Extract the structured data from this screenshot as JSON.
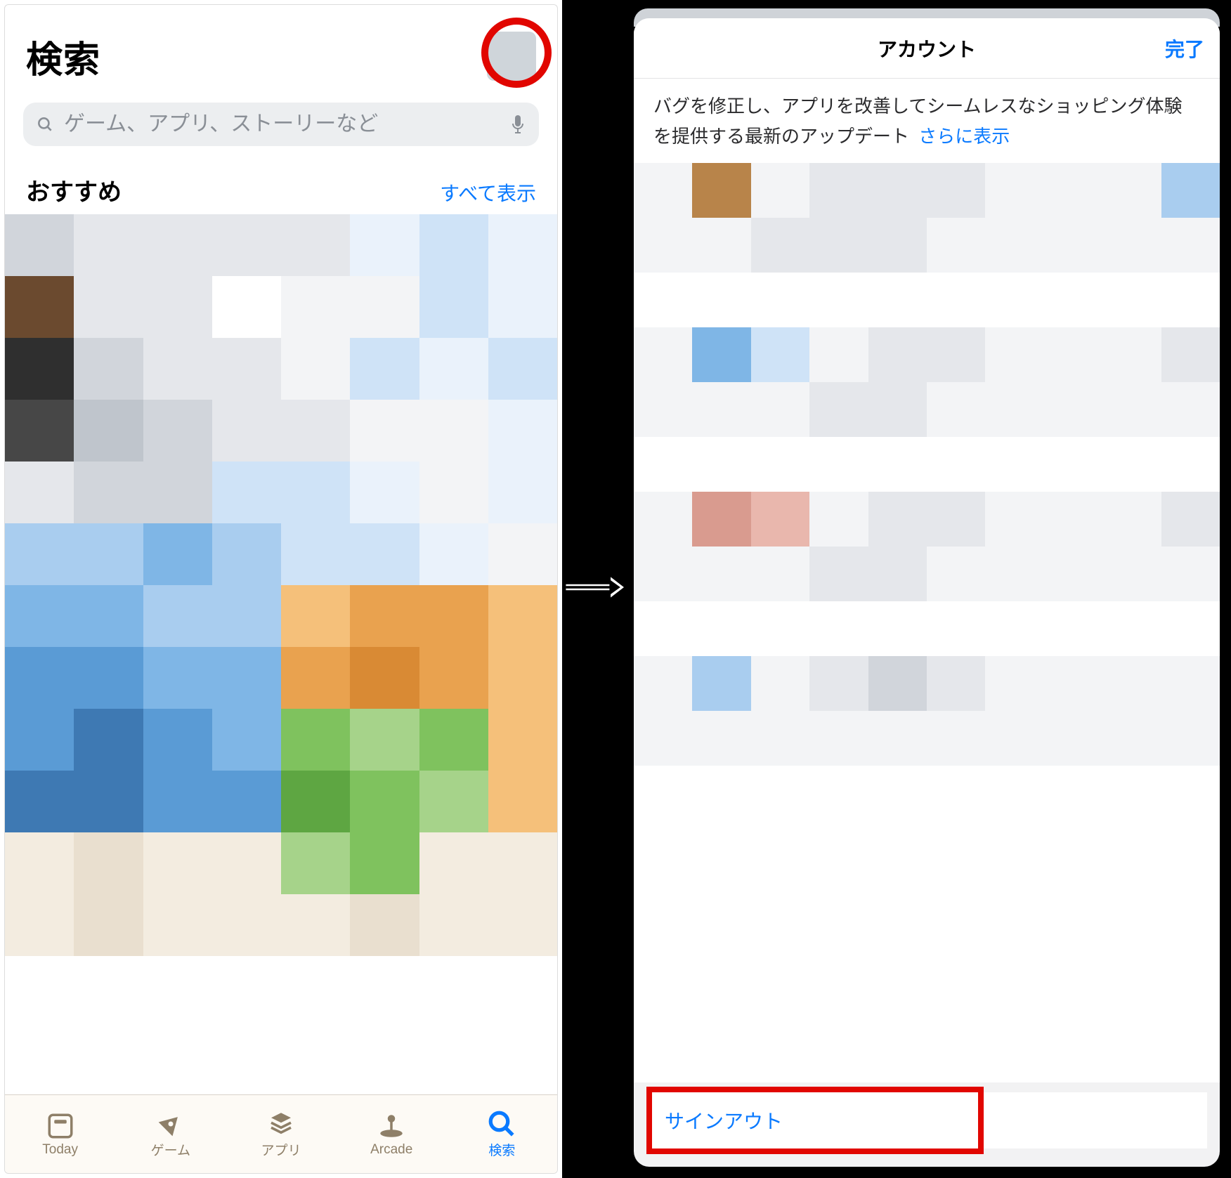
{
  "left": {
    "title": "検索",
    "search_placeholder": "ゲーム、アプリ、ストーリーなど",
    "section_title": "おすすめ",
    "show_all": "すべて表示"
  },
  "tabs": {
    "today": "Today",
    "games": "ゲーム",
    "apps": "アプリ",
    "arcade": "Arcade",
    "search": "検索"
  },
  "sheet": {
    "title": "アカウント",
    "done": "完了",
    "update_desc": "バグを修正し、アプリを改善してシームレスなショッピング体験を提供する最新のアップデート",
    "more": "さらに表示",
    "signout": "サインアウト"
  },
  "colors": {
    "accent": "#0a7aff",
    "highlight": "#e10600"
  }
}
